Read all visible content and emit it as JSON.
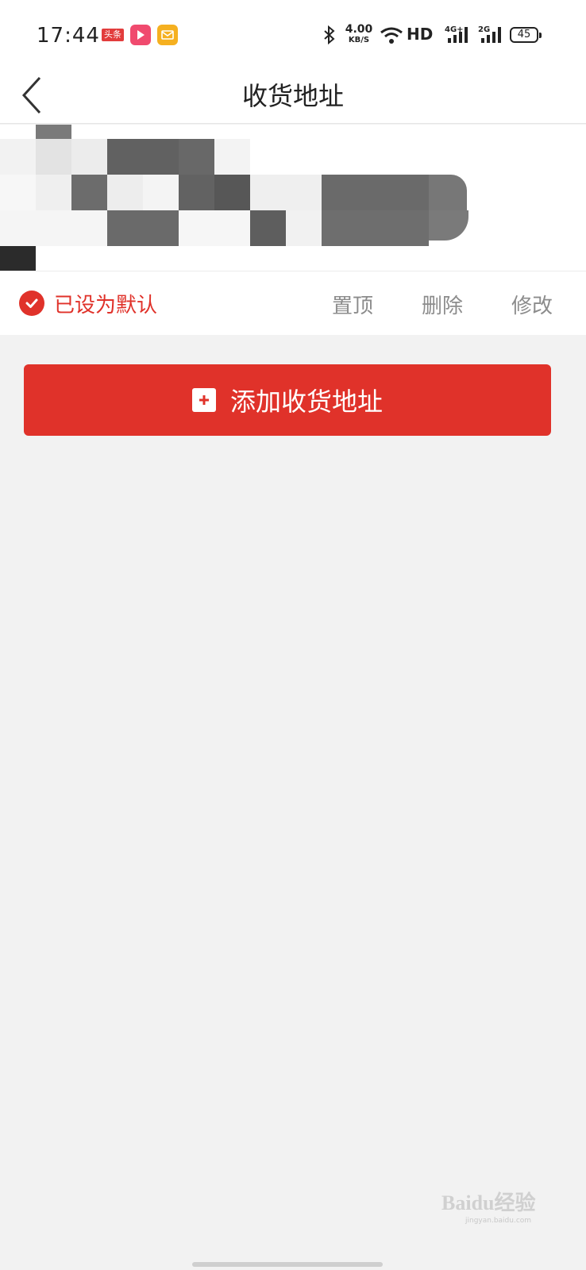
{
  "status_bar": {
    "time": "17:44",
    "toutiao_badge": "头条",
    "net_speed": "4.00",
    "net_speed_unit": "KB/S",
    "hd_label": "HD",
    "signal_1_label": "4G",
    "signal_2_label": "2G",
    "battery": "45"
  },
  "nav": {
    "title": "收货地址"
  },
  "address_card": {
    "default_label": "已设为默认",
    "actions": {
      "pin_top": "置顶",
      "delete": "删除",
      "edit": "修改"
    }
  },
  "add_button": {
    "label": "添加收货地址"
  },
  "watermark": {
    "brand": "Baidu经验",
    "url": "jingyan.baidu.com"
  },
  "colors": {
    "accent": "#e0322a",
    "background": "#f2f2f2",
    "card": "#ffffff",
    "action_text": "#8c8c8c"
  }
}
